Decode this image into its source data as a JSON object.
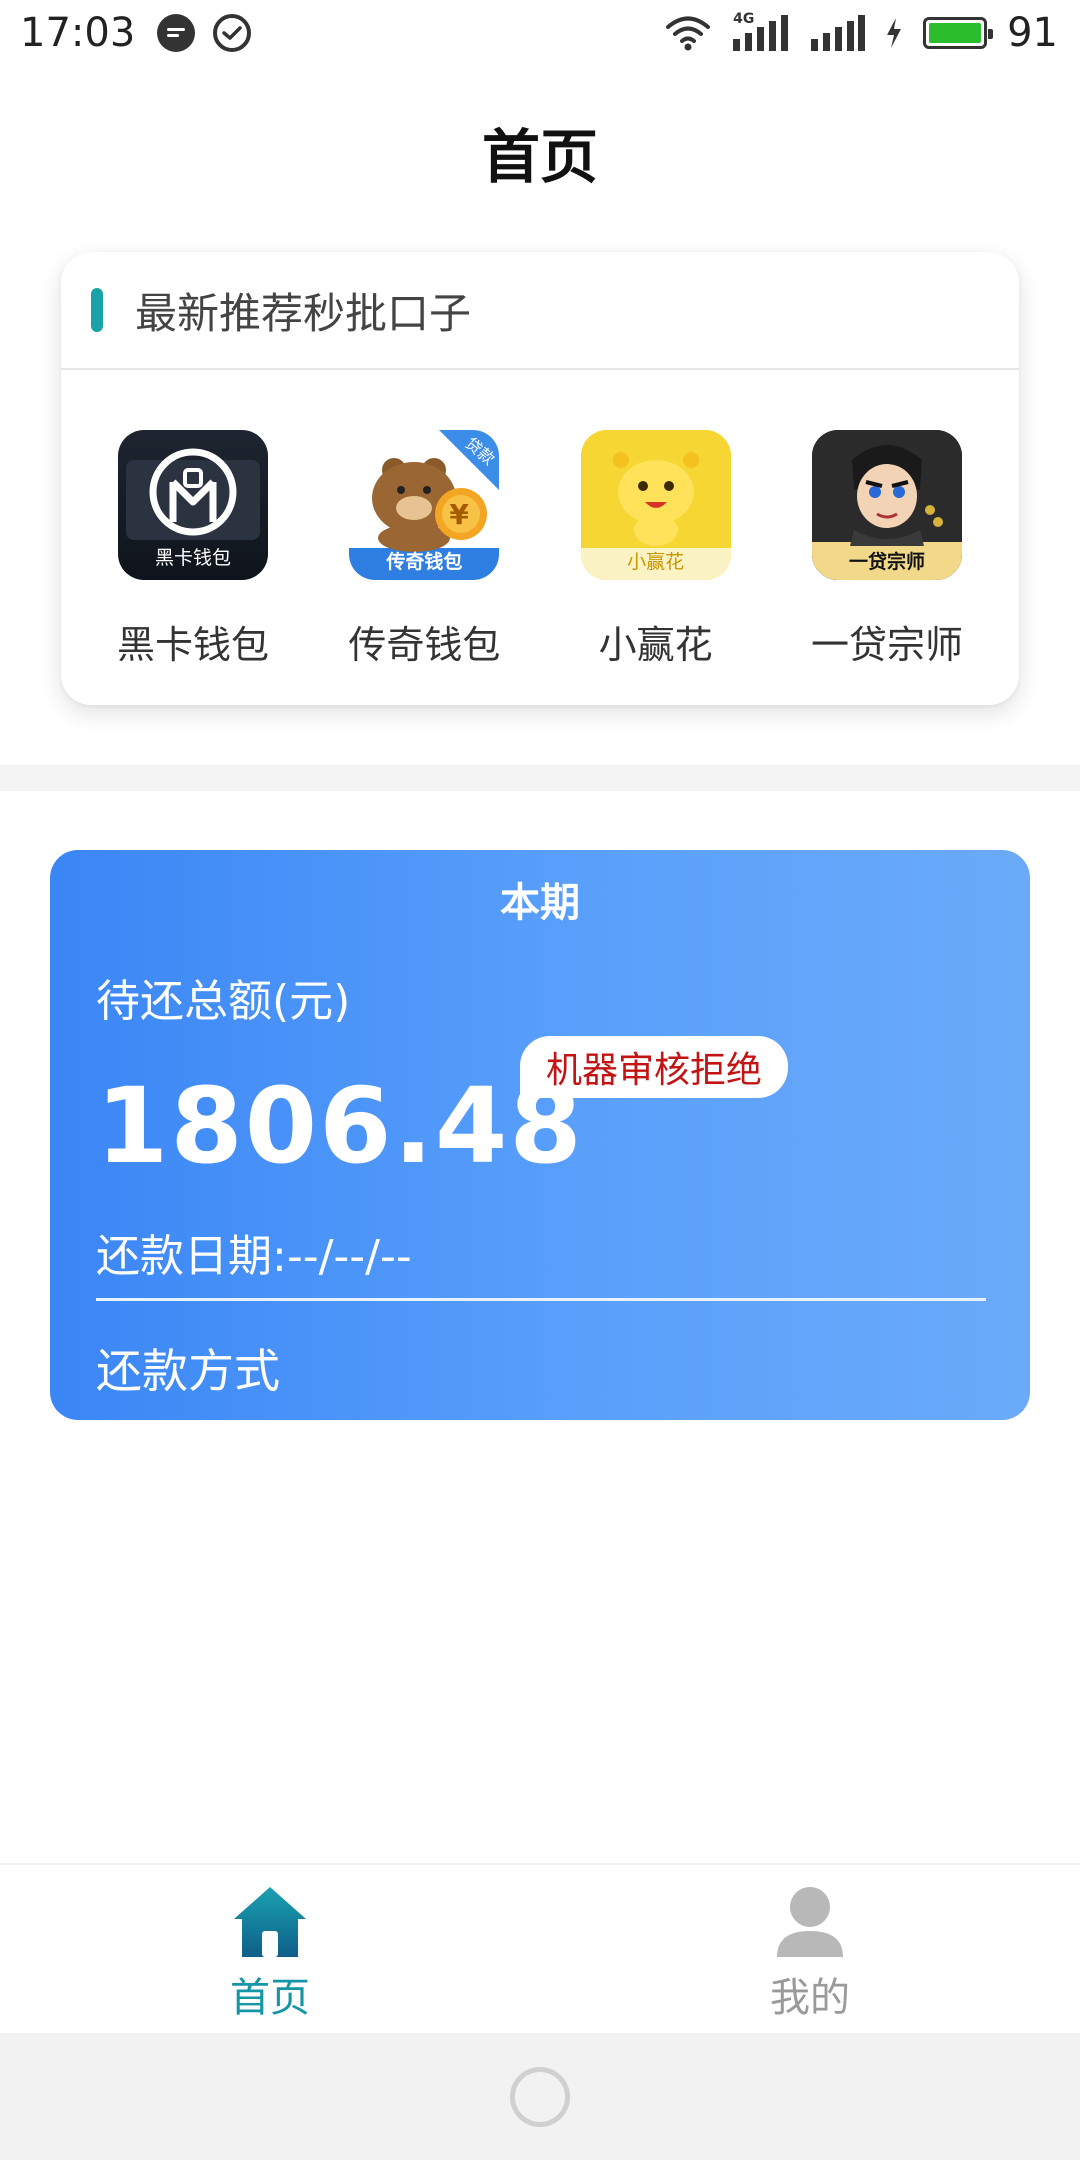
{
  "status_bar": {
    "time": "17:03",
    "network_label": "4G",
    "battery_level": "91",
    "icons": [
      "message-icon",
      "check-circle-icon",
      "wifi-icon",
      "signal-4g-icon",
      "signal-icon",
      "charging-icon",
      "battery-icon"
    ]
  },
  "header": {
    "title": "首页"
  },
  "recommend": {
    "title": "最新推荐秒批口子",
    "apps": [
      {
        "name": "黑卡钱包",
        "icon_text": "黑卡钱包"
      },
      {
        "name": "传奇钱包",
        "icon_text": "传奇钱包",
        "corner_tag": "贷款"
      },
      {
        "name": "小赢花",
        "icon_text": "小赢花"
      },
      {
        "name": "一贷宗师",
        "icon_text": "一贷宗师"
      }
    ]
  },
  "bill": {
    "period": "本期",
    "amount_label": "待还总额(元)",
    "amount": "1806.48",
    "status_badge": "机器审核拒绝",
    "due_date": "还款日期:--/--/--",
    "method_label": "还款方式"
  },
  "bottom_nav": {
    "items": [
      {
        "label": "首页",
        "active": true,
        "icon": "home-icon"
      },
      {
        "label": "我的",
        "active": false,
        "icon": "user-icon"
      }
    ]
  },
  "colors": {
    "accent": "#1aa3a6",
    "card_gradient_start": "#3a86f5",
    "card_gradient_end": "#6aaaf9",
    "badge_text": "#c21414",
    "nav_active": "#1596a6",
    "nav_inactive": "#9a9a9a"
  }
}
